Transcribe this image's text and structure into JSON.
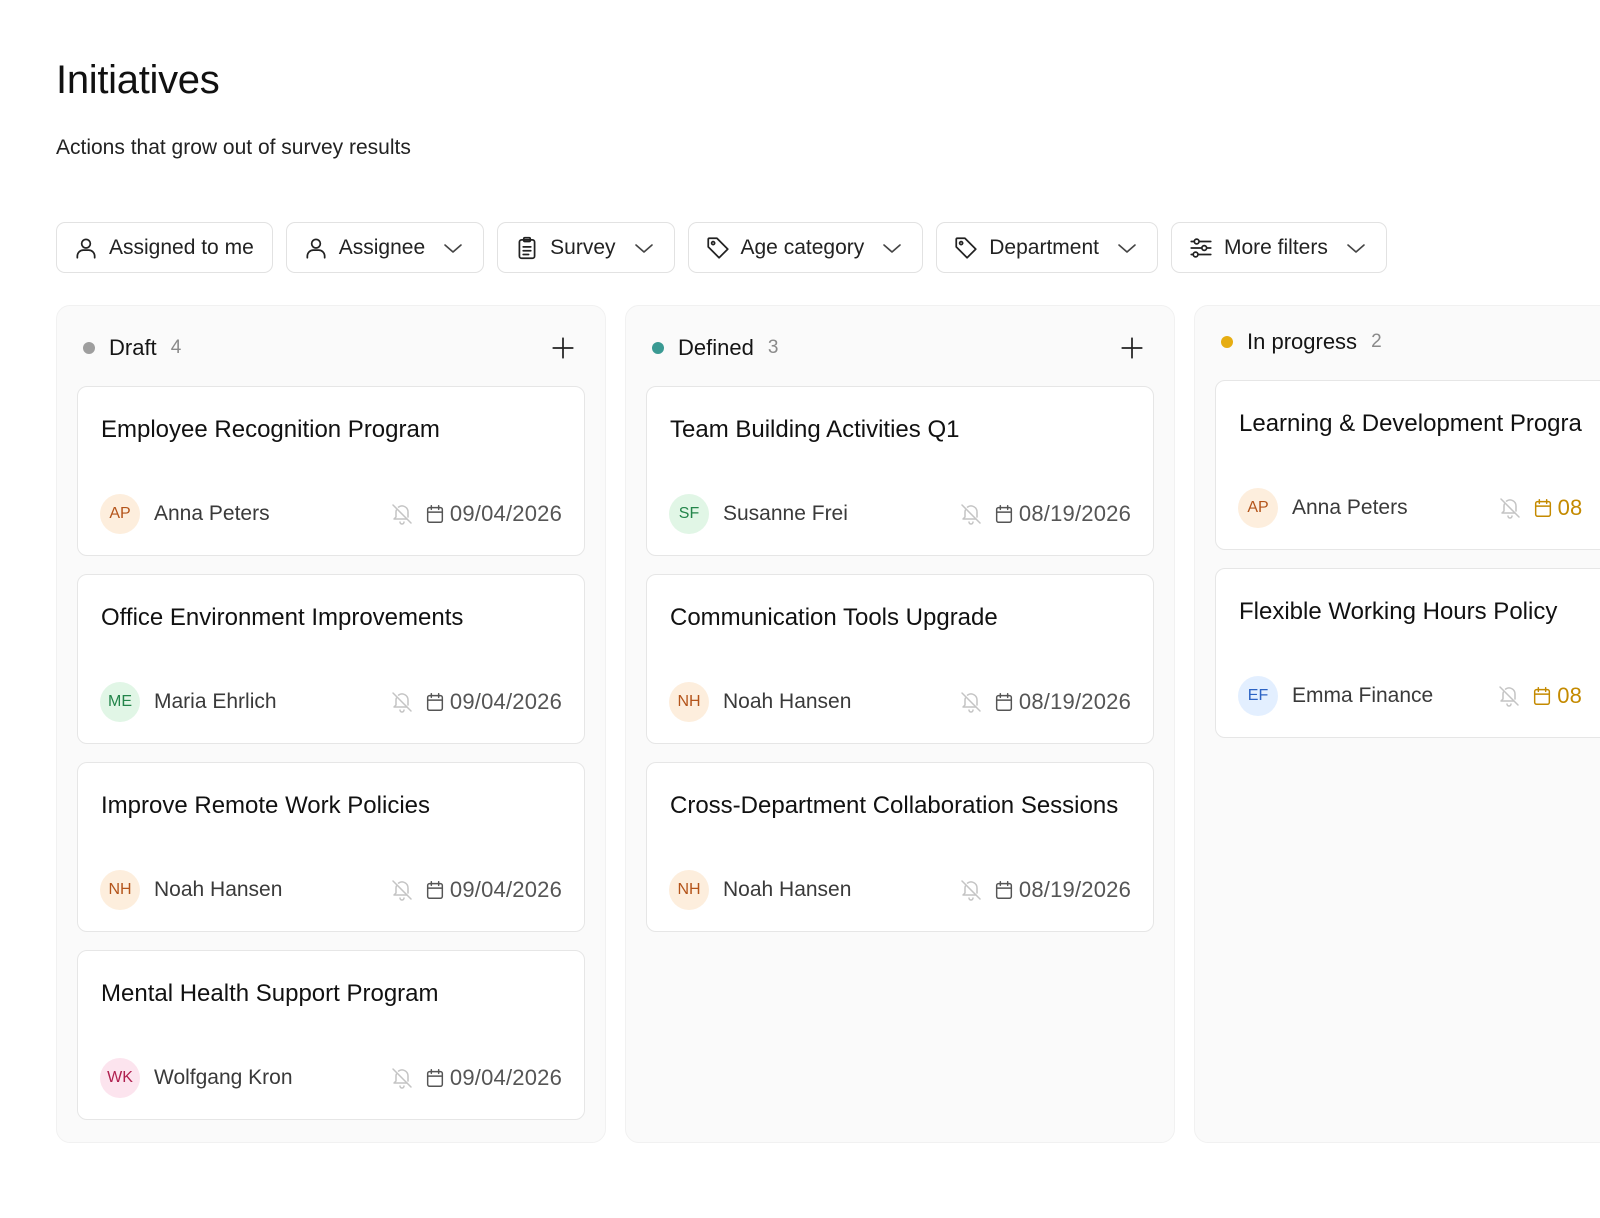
{
  "page": {
    "title": "Initiatives",
    "subtitle": "Actions that grow out of survey results"
  },
  "filters": [
    {
      "label": "Assigned to me",
      "icon": "user-icon",
      "has_dropdown": false
    },
    {
      "label": "Assignee",
      "icon": "user-icon",
      "has_dropdown": true
    },
    {
      "label": "Survey",
      "icon": "clipboard-icon",
      "has_dropdown": true
    },
    {
      "label": "Age category",
      "icon": "tag-icon",
      "has_dropdown": true
    },
    {
      "label": "Department",
      "icon": "tag-icon",
      "has_dropdown": true
    },
    {
      "label": "More filters",
      "icon": "sliders-icon",
      "has_dropdown": true
    }
  ],
  "colors": {
    "draft": "#9e9e9e",
    "defined": "#3a9a93",
    "in_progress": "#e6ad12",
    "warn_date": "#c48a00"
  },
  "avatar_styles": {
    "AP": {
      "bg": "#fdeedd",
      "fg": "#b4541a"
    },
    "ME": {
      "bg": "#e1f6e6",
      "fg": "#23854a"
    },
    "NH": {
      "bg": "#fdeedd",
      "fg": "#b4541a"
    },
    "WK": {
      "bg": "#fce4ee",
      "fg": "#b0204f"
    },
    "SF": {
      "bg": "#e1f6e6",
      "fg": "#23854a"
    },
    "EF": {
      "bg": "#e3efff",
      "fg": "#2c63c4"
    }
  },
  "columns": {
    "draft": {
      "name": "Draft",
      "count": "4",
      "cards": [
        {
          "title": "Employee Recognition Program",
          "initials": "AP",
          "assignee": "Anna Peters",
          "date": "09/04/2026"
        },
        {
          "title": "Office Environment Improvements",
          "initials": "ME",
          "assignee": "Maria Ehrlich",
          "date": "09/04/2026"
        },
        {
          "title": "Improve Remote Work Policies",
          "initials": "NH",
          "assignee": "Noah Hansen",
          "date": "09/04/2026"
        },
        {
          "title": "Mental Health Support Program",
          "initials": "WK",
          "assignee": "Wolfgang Kron",
          "date": "09/04/2026"
        }
      ]
    },
    "defined": {
      "name": "Defined",
      "count": "3",
      "cards": [
        {
          "title": "Team Building Activities Q1",
          "initials": "SF",
          "assignee": "Susanne Frei",
          "date": "08/19/2026"
        },
        {
          "title": "Communication Tools Upgrade",
          "initials": "NH",
          "assignee": "Noah Hansen",
          "date": "08/19/2026"
        },
        {
          "title": "Cross-Department Collaboration Sessions",
          "initials": "NH",
          "assignee": "Noah Hansen",
          "date": "08/19/2026"
        }
      ]
    },
    "in_progress": {
      "name": "In progress",
      "count": "2",
      "cards": [
        {
          "title": "Learning & Development Progra",
          "initials": "AP",
          "assignee": "Anna Peters",
          "date": "08"
        },
        {
          "title": "Flexible Working Hours Policy",
          "initials": "EF",
          "assignee": "Emma Finance",
          "date": "08"
        }
      ]
    }
  }
}
